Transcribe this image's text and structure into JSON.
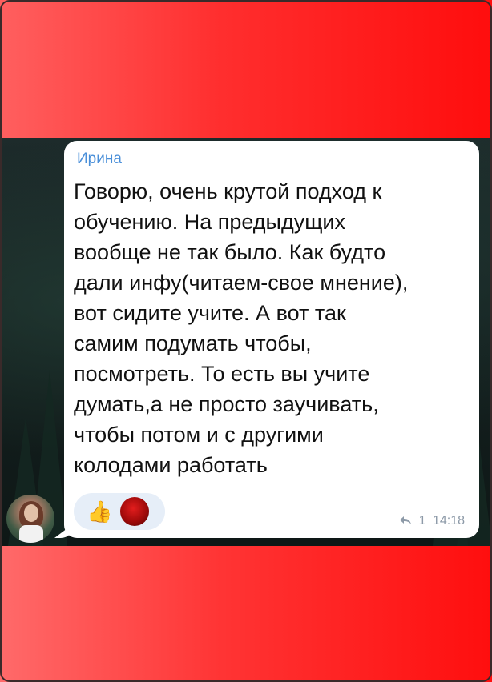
{
  "message": {
    "sender": "Ирина",
    "text": "Говорю, очень крутой подход к\nобучению. На предыдущих\nвообще не так было. Как будто\nдали инфу(читаем-свое мнение),\nвот сидите учите. А вот так\nсамим подумать чтобы,\nпосмотреть. То есть вы учите\nдумать,а не просто заучивать,\nчтобы потом и с другими\nколодами работать",
    "reactions": [
      {
        "type": "emoji",
        "glyph": "👍",
        "name": "thumbs-up"
      },
      {
        "type": "avatar",
        "name": "reactor-avatar"
      }
    ],
    "reply_count": "1",
    "time": "14:18",
    "reply_icon": "reply-arrow-icon"
  },
  "colors": {
    "band_top": "#ff2e2e",
    "band_bottom": "#ff3434",
    "sender_name": "#4a8fd9",
    "meta_text": "#8d9aa8",
    "bubble": "#ffffff"
  }
}
